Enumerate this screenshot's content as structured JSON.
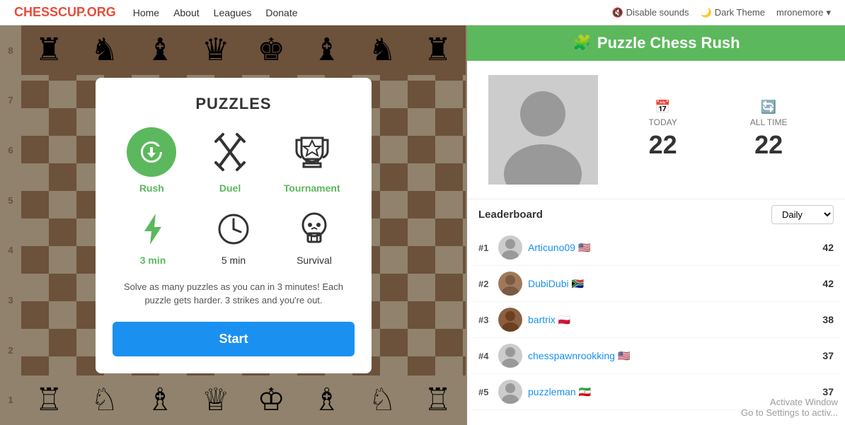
{
  "header": {
    "logo": "CHESSCUP.ORG",
    "nav": [
      {
        "label": "Home",
        "id": "home"
      },
      {
        "label": "About",
        "id": "about"
      },
      {
        "label": "Leagues",
        "id": "leagues"
      },
      {
        "label": "Donate",
        "id": "donate"
      }
    ],
    "disable_sounds": "Disable sounds",
    "dark_theme": "Dark Theme",
    "user": "mronemore",
    "dropdown_icon": "▾"
  },
  "puzzle_modal": {
    "title": "PUZZLES",
    "modes": [
      {
        "id": "rush",
        "label": "Rush",
        "active": true
      },
      {
        "id": "duel",
        "label": "Duel",
        "active": false
      },
      {
        "id": "tournament",
        "label": "Tournament",
        "active": false
      }
    ],
    "time_modes": [
      {
        "id": "3min",
        "label": "3 min",
        "active": true
      },
      {
        "id": "5min",
        "label": "5 min",
        "active": false
      },
      {
        "id": "survival",
        "label": "Survival",
        "active": false
      }
    ],
    "description": "Solve as many puzzles as you can in 3 minutes! Each puzzle gets harder. 3 strikes and you're out.",
    "start_button": "Start"
  },
  "right_panel": {
    "header": "Puzzle Chess Rush",
    "puzzle_icon": "🧩",
    "stats": {
      "today_label": "TODAY",
      "today_value": "22",
      "alltime_label": "ALL TIME",
      "alltime_value": "22"
    },
    "leaderboard_title": "Leaderboard",
    "leaderboard_filter": "Daily",
    "leaderboard_items": [
      {
        "rank": "#1",
        "name": "Articuno09",
        "flag": "🇺🇸",
        "score": "42",
        "avatar_color": "#ccc"
      },
      {
        "rank": "#2",
        "name": "DubiDubi",
        "flag": "🇿🇦",
        "score": "42",
        "avatar_color": "#a0785a"
      },
      {
        "rank": "#3",
        "name": "bartrix",
        "flag": "🇵🇱",
        "score": "38",
        "avatar_color": "#8a6040"
      },
      {
        "rank": "#4",
        "name": "chesspawnrookking",
        "flag": "🇺🇸",
        "score": "37",
        "avatar_color": "#ccc"
      },
      {
        "rank": "#5",
        "name": "puzzleman",
        "flag": "🇮🇷",
        "score": "37",
        "avatar_color": "#ccc"
      }
    ]
  },
  "board": {
    "top_pieces": [
      "♜",
      "♞",
      "♝",
      "♛",
      "♚",
      "♝",
      "♞",
      "♜"
    ],
    "bottom_pieces": [
      "♖",
      "♘",
      "♗",
      "♕",
      "♔",
      "♗",
      "♘",
      "♖"
    ],
    "rank_labels": [
      "8",
      "7",
      "6",
      "5",
      "4",
      "3",
      "2",
      "1"
    ]
  }
}
